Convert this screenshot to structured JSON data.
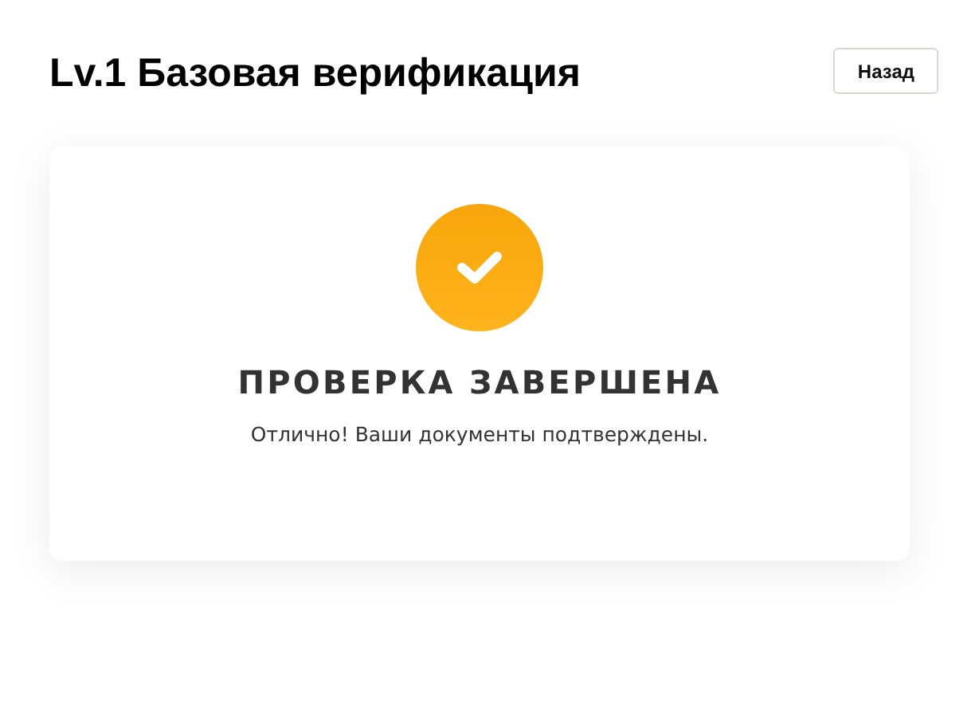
{
  "header": {
    "title": "Lv.1 Базовая верификация",
    "back_button": "Назад"
  },
  "card": {
    "completed": true,
    "heading": "ПРОВЕРКА ЗАВЕРШЕНА",
    "message": "Отлично! Ваши документы подтверждены."
  }
}
